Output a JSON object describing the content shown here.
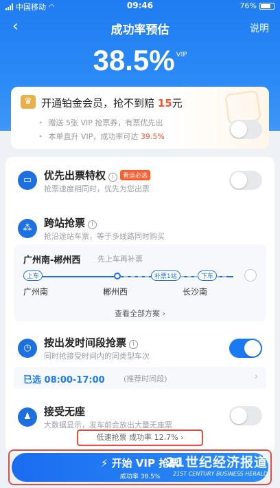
{
  "status": {
    "carrier": "中国移动",
    "time": "09:46",
    "battery": "76%"
  },
  "nav": {
    "back_icon": "chevron-left-icon",
    "title": "成功率预估",
    "help": "说明"
  },
  "rate": {
    "value": "38.5%",
    "badge": "VIP"
  },
  "vip_card": {
    "headline": "开通铂金会员，抢不到赔",
    "amount": "15",
    "unit": "元",
    "line1": "赠送 5张 VIP 抢票券，有票优先出",
    "line2_prefix": "本单直升 VIP，成功率可达",
    "line2_rate": "39.5%",
    "toggle_on": false
  },
  "features": {
    "priority": {
      "title": "优先出票特权",
      "tag": "看运必选",
      "desc": "抢票速度相同时，优先为您出票",
      "toggle_on": false
    },
    "cross": {
      "title": "跨站抢票",
      "desc": "抢沿途站车票，等于多线路同时购买"
    },
    "time": {
      "title": "按出发时间段抢票",
      "desc": "同时抢接受时间内的同类型车次",
      "toggle_on": true
    },
    "standing": {
      "title": "接受无座",
      "desc": "大数据显示，发车前会放出大量无座票",
      "toggle_on": false
    }
  },
  "route": {
    "name": "广州南-郴州西",
    "note": "先上车再补票",
    "board_label": "上车",
    "extend_label": "补票1站",
    "alight_label": "下车",
    "stations": [
      "广州南",
      "郴州西",
      "长沙南"
    ],
    "see_all": "查看全部方案"
  },
  "time_select": {
    "selected": "已选 08:00-17:00",
    "recommend": "(推荐时间段)"
  },
  "low_speed": "低速抢票 成功率 12.7%",
  "cta": {
    "label": "开始 VIP 抢票",
    "sub": "成功率 38.5%"
  },
  "watermark": {
    "cn": "21世纪经济报道",
    "en": "21ST CENTURY BUSINESS HERALD"
  },
  "colors": {
    "primary": "#1a7af0",
    "red": "#ff4f2d",
    "gold": "#e9b04a"
  }
}
